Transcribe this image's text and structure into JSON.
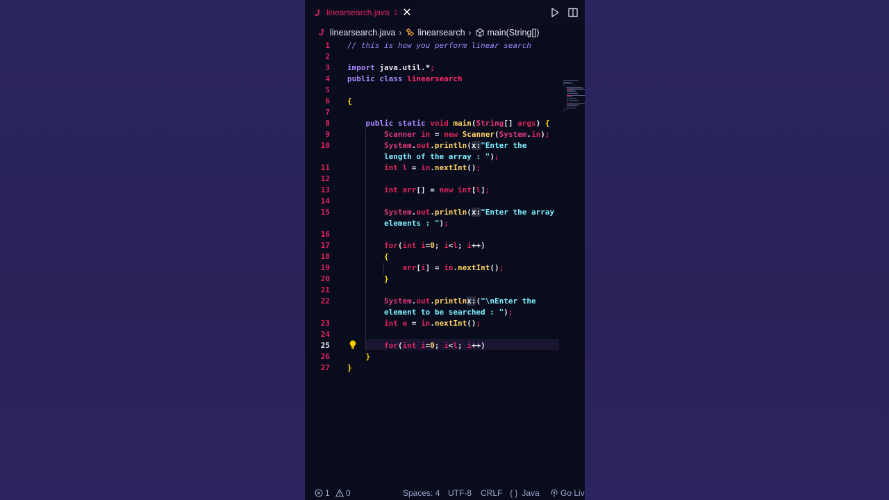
{
  "tab": {
    "icon_letter": "J",
    "label": "linearsearch.java",
    "problem_count": "1",
    "close_glyph": "✕"
  },
  "toolbar": {
    "run_icon": "play-icon",
    "split_icon": "split-editor-icon"
  },
  "breadcrumb": {
    "icon_letter": "J",
    "file": "linearsearch.java",
    "class_name": "linearsearch",
    "method_name": "main(String[])"
  },
  "editor": {
    "current_line": 25,
    "lines": [
      {
        "n": "1",
        "html": "<span class='c-comment'>// this is how you perform linear search</span>"
      },
      {
        "n": "2",
        "html": ""
      },
      {
        "n": "3",
        "html": "<span class='c-kw'>import</span> java.util.*<span class='c-pink'>;</span>"
      },
      {
        "n": "4",
        "html": "<span class='c-kw'>public class</span> <span class='c-class'>linearsearch</span>"
      },
      {
        "n": "5",
        "html": ""
      },
      {
        "n": "6",
        "html": "<span class='c-brace'>{</span>"
      },
      {
        "n": "7",
        "html": ""
      },
      {
        "n": "8",
        "html": "    <span class='c-kw'>public static</span> <span class='c-pink'>void</span> <span class='c-fn'>main</span>(<span class='c-cls'>String</span>[] <span class='c-pink'>args</span>) <span class='c-brace'>{</span>"
      },
      {
        "n": "9",
        "html": "        <span class='c-cls'>Scanner</span> <span class='c-pink'>in</span> = <span class='c-pink'>new</span> <span class='c-fn'>Scanner</span>(<span class='c-cls'>System</span>.<span class='c-pink'>in</span>)<span class='c-pink'>;</span>"
      },
      {
        "n": "10",
        "html": "        <span class='c-cls'>System</span>.<span class='c-pink'>out</span>.<span class='c-fn'>println</span>(<span class='c-hint'>x:</span><span class='c-str'>\"Enter the</span>"
      },
      {
        "n": "",
        "html": "        <span class='c-str'>length of the array : \"</span>)<span class='c-pink'>;</span>"
      },
      {
        "n": "11",
        "html": "        <span class='c-pink'>int l</span> = <span class='c-pink'>in</span>.<span class='c-fn'>nextInt</span>()<span class='c-pink'>;</span>"
      },
      {
        "n": "12",
        "html": ""
      },
      {
        "n": "13",
        "html": "        <span class='c-pink'>int arr</span>[] = <span class='c-pink'>new int</span>[<span class='c-pink'>l</span>]<span class='c-pink'>;</span>"
      },
      {
        "n": "14",
        "html": ""
      },
      {
        "n": "15",
        "html": "        <span class='c-cls'>System</span>.<span class='c-pink'>out</span>.<span class='c-fn'>println</span>(<span class='c-hint'>x:</span><span class='c-str'>\"Enter the array</span>"
      },
      {
        "n": "",
        "html": "        <span class='c-str'>elements : \"</span>)<span class='c-pink'>;</span>"
      },
      {
        "n": "16",
        "html": ""
      },
      {
        "n": "17",
        "html": "        <span class='c-pink'>for</span>(<span class='c-pink'>int i</span>=<span class='c-fn'>0</span>; <span class='c-pink'>i</span>&lt;<span class='c-pink'>l</span>; <span class='c-pink'>i</span>++)"
      },
      {
        "n": "18",
        "html": "        <span class='c-brace'>{</span>"
      },
      {
        "n": "19",
        "html": "            <span class='c-pink'>arr</span>[<span class='c-pink'>i</span>] = <span class='c-pink'>in</span>.<span class='c-fn'>nextInt</span>()<span class='c-pink'>;</span>"
      },
      {
        "n": "20",
        "html": "        <span class='c-brace'>}</span>"
      },
      {
        "n": "21",
        "html": ""
      },
      {
        "n": "22",
        "html": "        <span class='c-cls'>System</span>.<span class='c-pink'>out</span>.<span class='c-fn'>println</span><span class='c-hint'>x:</span>(<span class='c-str'>\"\\nEnter the</span>"
      },
      {
        "n": "",
        "html": "        <span class='c-str'>element to be searched : \"</span>)<span class='c-pink'>;</span>"
      },
      {
        "n": "23",
        "html": "        <span class='c-pink'>int e</span> = <span class='c-pink'>in</span>.<span class='c-fn'>nextInt</span>()<span class='c-pink'>;</span>"
      },
      {
        "n": "24",
        "html": ""
      },
      {
        "n": "25",
        "html": "        <span class='c-pink'>for</span>(<span class='c-pink'>int i</span>=<span class='c-fn'>0</span>; <span class='c-pink'>i</span>&lt;<span class='c-pink'>l</span>; <span class='c-pink'>i</span>++)"
      },
      {
        "n": "26",
        "html": "    <span class='c-brace'>}</span>"
      },
      {
        "n": "27",
        "html": "<span class='c-brace'>}</span>"
      }
    ]
  },
  "statusbar": {
    "errors": "1",
    "warnings": "0",
    "spaces": "Spaces: 4",
    "encoding": "UTF-8",
    "eol": "CRLF",
    "language": "Java",
    "live": "Go Live"
  }
}
